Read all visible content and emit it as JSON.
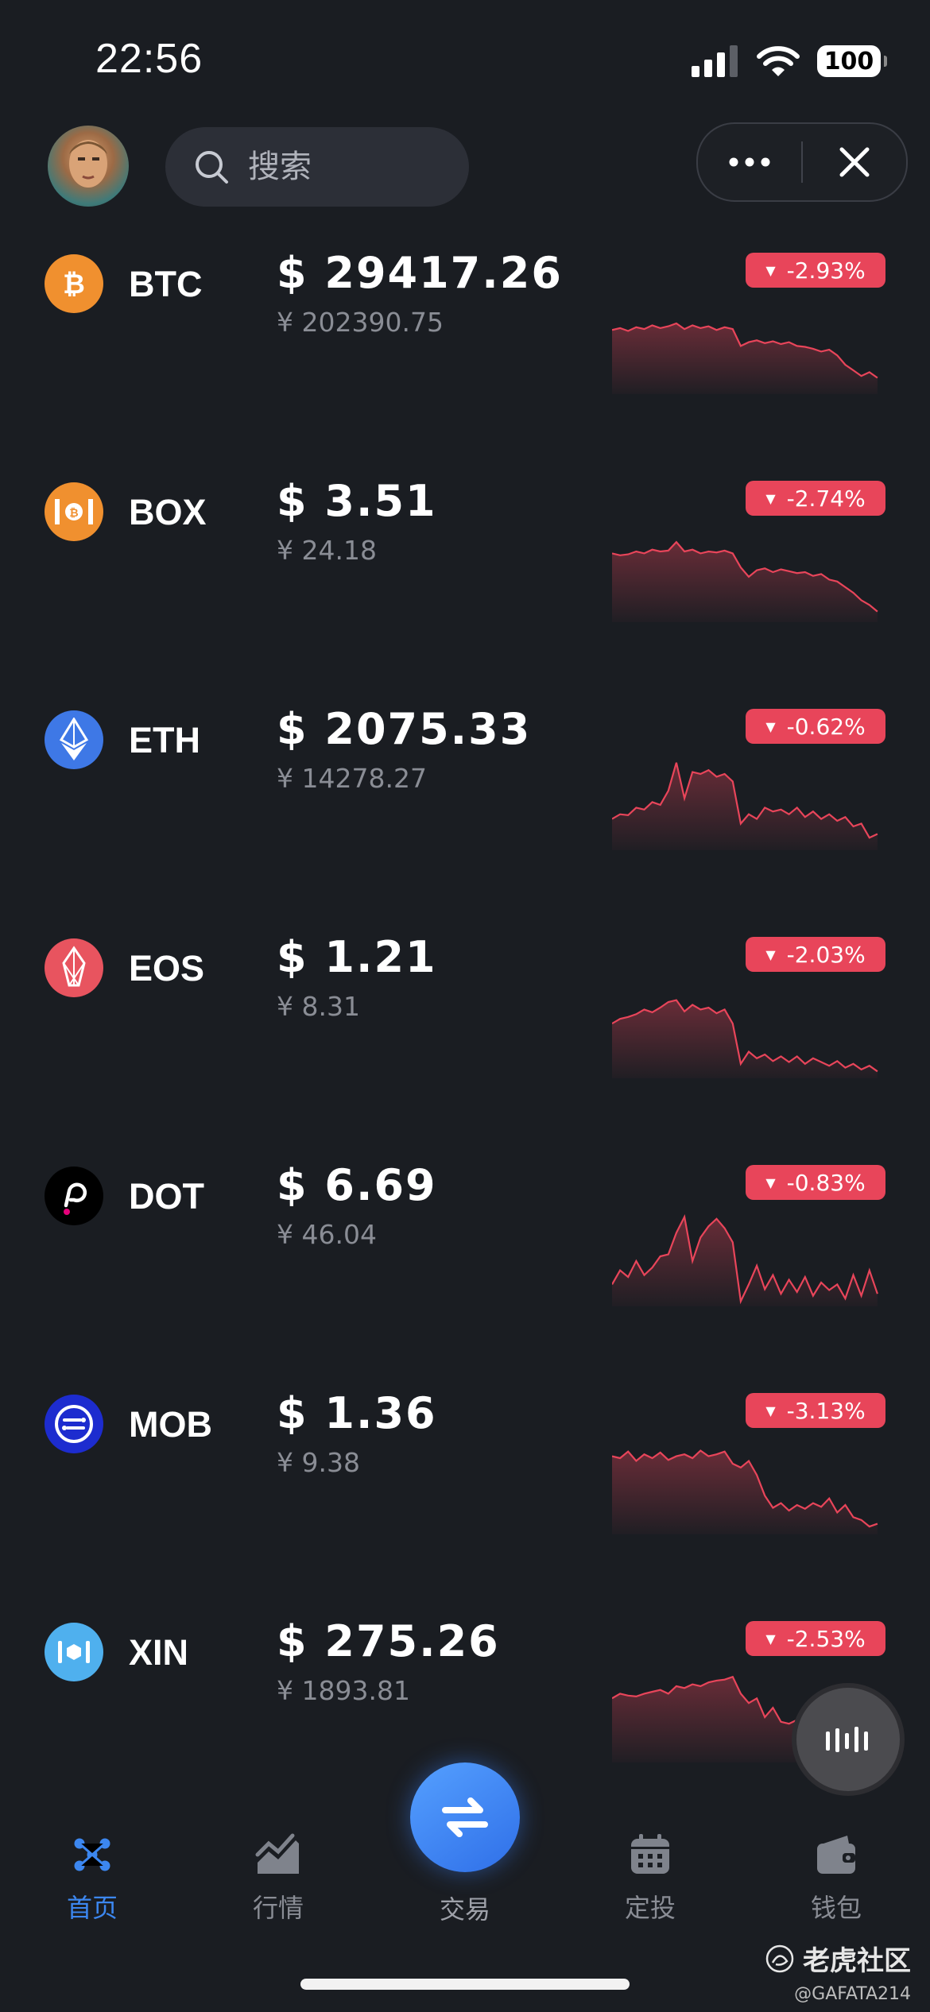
{
  "status_bar": {
    "time": "22:56",
    "battery": "100"
  },
  "header": {
    "search_placeholder": "搜索"
  },
  "coins": [
    {
      "symbol": "BTC",
      "price_usd": "$ 29417.26",
      "price_cny": "¥ 202390.75",
      "change": "-2.93%",
      "icon": "bitcoin-icon",
      "icon_color": "#f0902f",
      "sparkline": [
        0.35,
        0.33,
        0.36,
        0.32,
        0.34,
        0.3,
        0.33,
        0.31,
        0.28,
        0.34,
        0.3,
        0.33,
        0.31,
        0.35,
        0.32,
        0.34,
        0.52,
        0.48,
        0.46,
        0.49,
        0.47,
        0.5,
        0.48,
        0.52,
        0.53,
        0.55,
        0.58,
        0.56,
        0.62,
        0.72,
        0.78,
        0.84,
        0.8,
        0.86
      ]
    },
    {
      "symbol": "BOX",
      "price_usd": "$ 3.51",
      "price_cny": "¥ 24.18",
      "change": "-2.74%",
      "icon": "box-icon",
      "icon_color": "#f0902f",
      "sparkline": [
        0.3,
        0.32,
        0.31,
        0.28,
        0.3,
        0.26,
        0.28,
        0.27,
        0.18,
        0.28,
        0.26,
        0.3,
        0.28,
        0.29,
        0.27,
        0.3,
        0.45,
        0.55,
        0.48,
        0.46,
        0.5,
        0.47,
        0.49,
        0.51,
        0.5,
        0.54,
        0.52,
        0.58,
        0.6,
        0.66,
        0.72,
        0.8,
        0.85,
        0.92
      ]
    },
    {
      "symbol": "ETH",
      "price_usd": "$ 2075.33",
      "price_cny": "¥ 14278.27",
      "change": "-0.62%",
      "icon": "ethereum-icon",
      "icon_color": "#3e78e6",
      "sparkline": [
        0.7,
        0.65,
        0.66,
        0.58,
        0.6,
        0.52,
        0.55,
        0.4,
        0.1,
        0.48,
        0.2,
        0.22,
        0.18,
        0.25,
        0.22,
        0.3,
        0.75,
        0.65,
        0.7,
        0.58,
        0.62,
        0.6,
        0.65,
        0.58,
        0.68,
        0.62,
        0.7,
        0.65,
        0.72,
        0.68,
        0.78,
        0.75,
        0.9,
        0.86
      ]
    },
    {
      "symbol": "EOS",
      "price_usd": "$ 1.21",
      "price_cny": "¥ 8.31",
      "change": "-2.03%",
      "icon": "eos-icon",
      "icon_color": "#e8545f",
      "sparkline": [
        0.45,
        0.4,
        0.38,
        0.35,
        0.3,
        0.33,
        0.28,
        0.22,
        0.2,
        0.32,
        0.25,
        0.3,
        0.28,
        0.34,
        0.3,
        0.45,
        0.88,
        0.75,
        0.82,
        0.78,
        0.85,
        0.8,
        0.86,
        0.8,
        0.88,
        0.82,
        0.86,
        0.9,
        0.85,
        0.92,
        0.88,
        0.94,
        0.9,
        0.96
      ]
    },
    {
      "symbol": "DOT",
      "price_usd": "$ 6.69",
      "price_cny": "¥ 46.04",
      "change": "-0.83%",
      "icon": "polkadot-icon",
      "icon_color": "#000000",
      "sparkline": [
        0.8,
        0.65,
        0.72,
        0.55,
        0.7,
        0.62,
        0.5,
        0.48,
        0.25,
        0.08,
        0.55,
        0.3,
        0.18,
        0.1,
        0.2,
        0.35,
        0.98,
        0.8,
        0.6,
        0.85,
        0.7,
        0.9,
        0.75,
        0.88,
        0.72,
        0.92,
        0.78,
        0.86,
        0.8,
        0.95,
        0.7,
        0.92,
        0.65,
        0.9
      ]
    },
    {
      "symbol": "MOB",
      "price_usd": "$ 1.36",
      "price_cny": "¥ 9.38",
      "change": "-3.13%",
      "icon": "mobilecoin-icon",
      "icon_color": "#1d2ccf",
      "sparkline": [
        0.2,
        0.22,
        0.15,
        0.25,
        0.18,
        0.22,
        0.16,
        0.24,
        0.2,
        0.18,
        0.22,
        0.14,
        0.2,
        0.18,
        0.15,
        0.28,
        0.32,
        0.25,
        0.4,
        0.62,
        0.75,
        0.7,
        0.78,
        0.72,
        0.76,
        0.7,
        0.74,
        0.65,
        0.8,
        0.72,
        0.85,
        0.88,
        0.95,
        0.92
      ]
    },
    {
      "symbol": "XIN",
      "price_usd": "$ 275.26",
      "price_cny": "¥ 1893.81",
      "change": "-2.53%",
      "icon": "mixin-icon",
      "icon_color": "#4fb0ee",
      "sparkline": [
        0.35,
        0.3,
        0.32,
        0.33,
        0.3,
        0.28,
        0.26,
        0.3,
        0.22,
        0.24,
        0.2,
        0.22,
        0.18,
        0.16,
        0.15,
        0.12,
        0.3,
        0.4,
        0.35,
        0.55,
        0.45,
        0.6,
        0.62,
        0.58,
        0.65,
        0.7,
        0.68,
        0.72
      ]
    }
  ],
  "tabs": [
    {
      "label": "首页",
      "icon": "home-dots-icon"
    },
    {
      "label": "行情",
      "icon": "chart-trend-icon"
    },
    {
      "label": "交易",
      "icon": "swap-icon"
    },
    {
      "label": "定投",
      "icon": "calendar-icon"
    },
    {
      "label": "钱包",
      "icon": "wallet-icon"
    }
  ],
  "watermark": {
    "title": "老虎社区",
    "handle": "@GAFATA214"
  },
  "colors": {
    "background": "#1a1d22",
    "down_red": "#e8455a",
    "active_blue": "#3c87f0"
  }
}
